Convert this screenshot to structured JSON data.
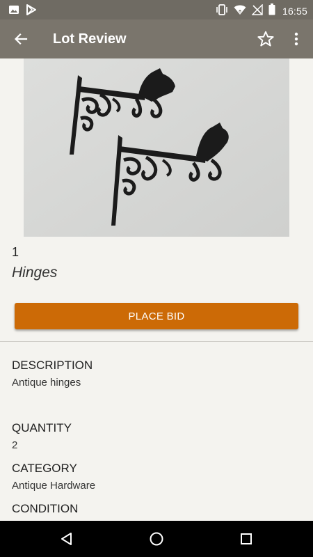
{
  "status_bar": {
    "time": "16:55",
    "left_icons": [
      "image-icon",
      "play-store-icon"
    ],
    "right_icons": [
      "vibrate-icon",
      "wifi-icon",
      "no-signal-icon",
      "battery-icon"
    ]
  },
  "app_bar": {
    "title": "Lot Review",
    "actions": [
      "back-arrow-icon",
      "star-outline-icon",
      "overflow-menu-icon"
    ]
  },
  "lot": {
    "number": "1",
    "title": "Hinges",
    "bid_button": "PLACE BID"
  },
  "details": {
    "description_label": "DESCRIPTION",
    "description_value": "Antique hinges",
    "quantity_label": "QUANTITY",
    "quantity_value": "2",
    "category_label": "CATEGORY",
    "category_value": "Antique Hardware",
    "condition_label": "CONDITION"
  },
  "nav_bar": {
    "buttons": [
      "back-triangle-icon",
      "home-circle-icon",
      "recents-square-icon"
    ]
  },
  "colors": {
    "status_bar": "#6f6b63",
    "app_bar": "#7a756c",
    "accent": "#cc6a06",
    "background": "#f4f3ef"
  }
}
